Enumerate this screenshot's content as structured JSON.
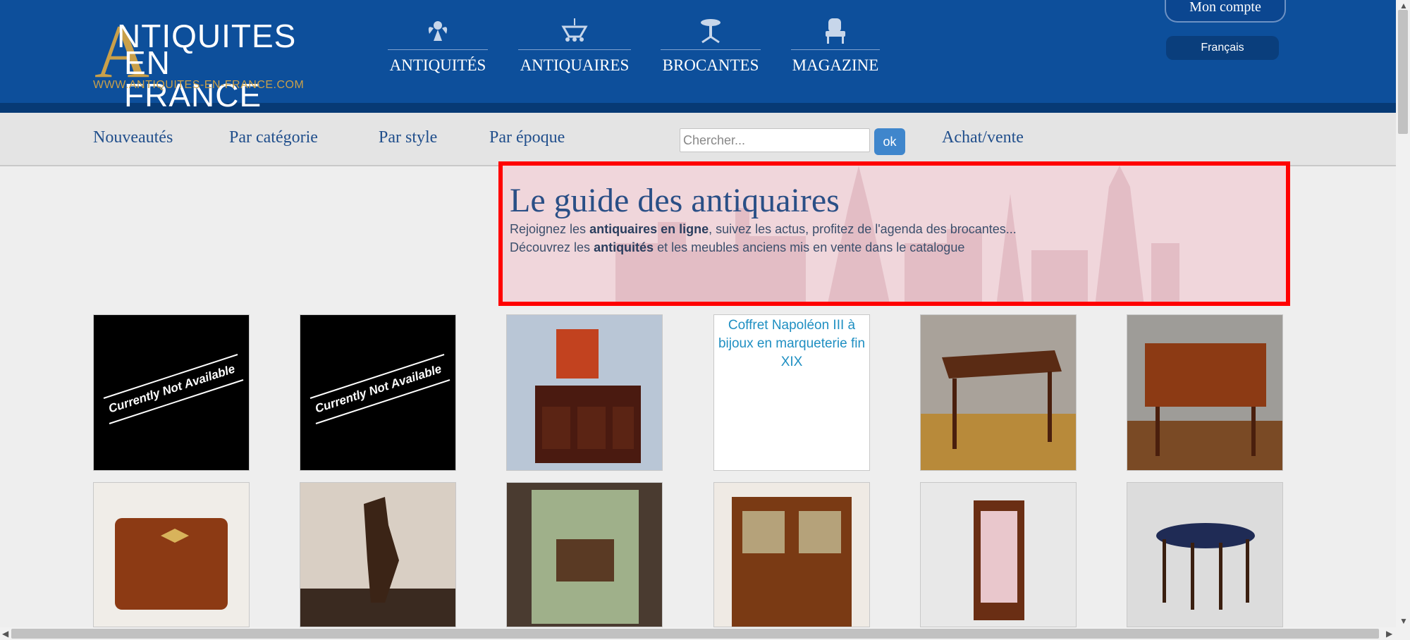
{
  "header": {
    "logo_line1": "NTIQUITES",
    "logo_letter": "A",
    "logo_line2": "EN FRANCE",
    "logo_url": "WWW.ANTIQUITES-EN-FRANCE.COM",
    "main_nav": [
      {
        "label": "ANTIQUITÉS",
        "icon": "cherub-icon"
      },
      {
        "label": "ANTIQUAIRES",
        "icon": "chandelier-icon"
      },
      {
        "label": "BROCANTES",
        "icon": "pedestal-table-icon"
      },
      {
        "label": "MAGAZINE",
        "icon": "armchair-icon"
      }
    ],
    "account_label": "Mon compte",
    "language_label": "Français"
  },
  "subnav": {
    "items": [
      "Nouveautés",
      "Par catégorie",
      "Par style",
      "Par époque"
    ],
    "search_placeholder": "Chercher...",
    "search_button": "ok",
    "buy_sell": "Achat/vente"
  },
  "hero": {
    "title": "Le guide des antiquaires",
    "line1_prefix": "Rejoignez les ",
    "line1_bold": "antiquaires en ligne",
    "line1_suffix": ", suivez les actus, profitez de l'agenda des brocantes...",
    "line2_prefix": "Découvrez les ",
    "line2_bold": "antiquités",
    "line2_suffix": " et les meubles anciens mis en vente dans le catalogue"
  },
  "products": {
    "unavailable_text": "Currently Not Available",
    "broken_image_alt": "Coffret Napoléon III à bijoux en marqueterie fin XIX",
    "row1": [
      "unavailable",
      "unavailable",
      "sideboard",
      "broken",
      "writing-table",
      "secretary-desk"
    ],
    "row2": [
      "jewelry-box",
      "carousel-horse",
      "tiled-stove",
      "bookcase-cabinet",
      "display-cabinet",
      "round-table"
    ]
  },
  "colors": {
    "header_blue": "#0d4f9b",
    "gold": "#c9a04a",
    "link_blue": "#214f8c",
    "highlight_border": "#ff0000"
  }
}
